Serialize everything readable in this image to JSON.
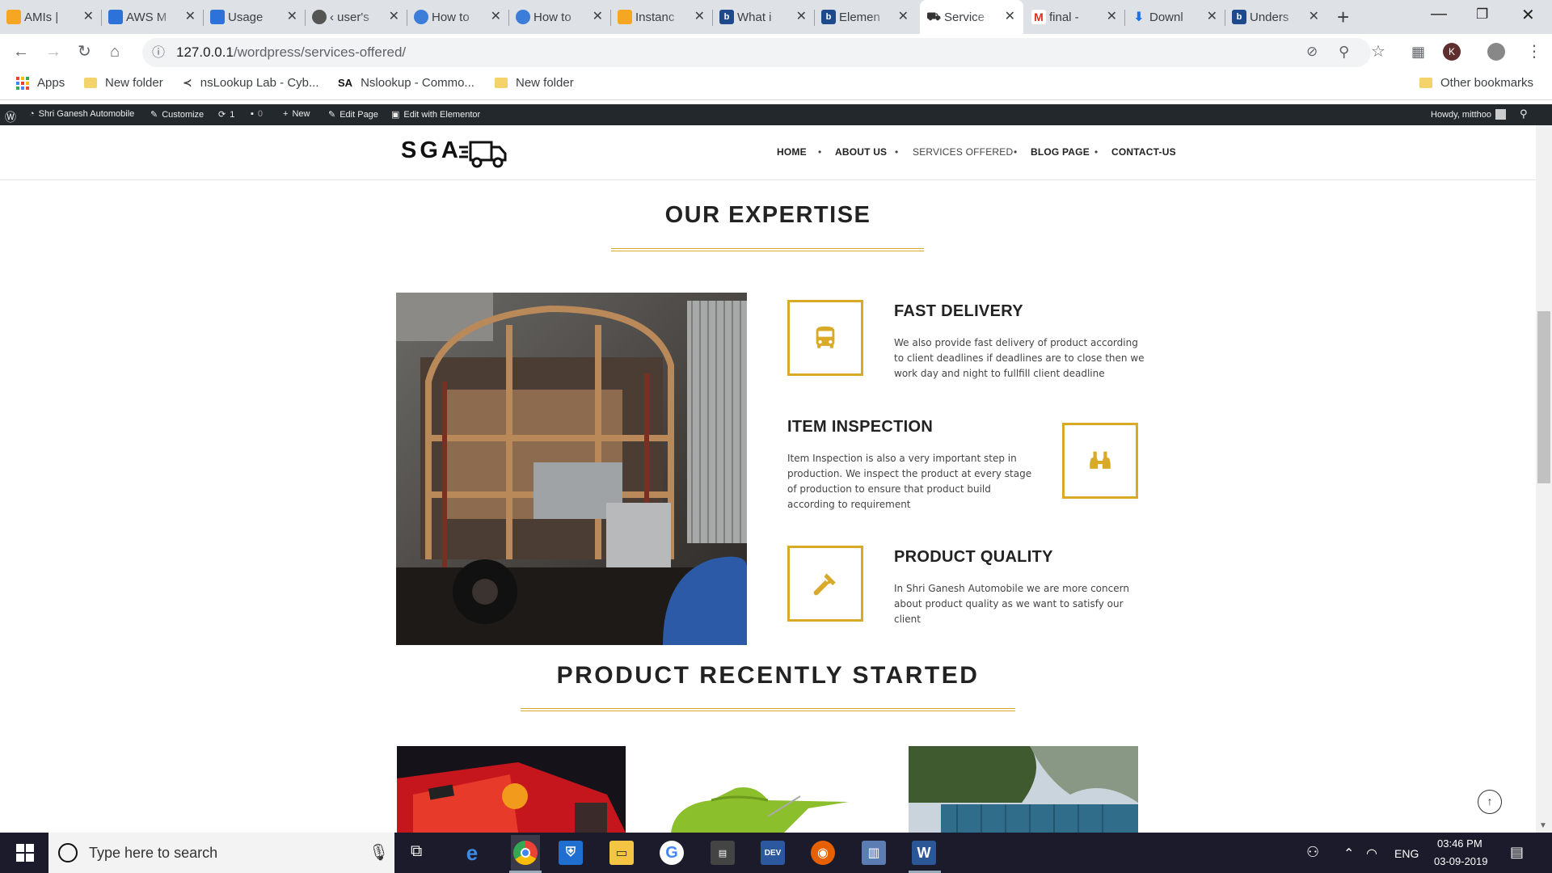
{
  "browser": {
    "tabs": [
      {
        "title": "AMIs |",
        "icon": "aws-cube-icon",
        "color": "#f5a623"
      },
      {
        "title": "AWS M",
        "icon": "aws-hex-icon",
        "color": "#2d72d9"
      },
      {
        "title": "Usage",
        "icon": "aws-hex-icon",
        "color": "#2d72d9"
      },
      {
        "title": "‹ user's",
        "icon": "wordpress-icon",
        "color": "#555555"
      },
      {
        "title": "How to",
        "icon": "people-icon",
        "color": "#3b7dd8"
      },
      {
        "title": "How to",
        "icon": "people-icon",
        "color": "#3b7dd8"
      },
      {
        "title": "Instanc",
        "icon": "aws-cube-icon",
        "color": "#f5a623"
      },
      {
        "title": "What i",
        "icon": "bing-icon",
        "color": "#1e4a8c"
      },
      {
        "title": "Elemen",
        "icon": "bing-icon",
        "color": "#1e4a8c"
      },
      {
        "title": "Service",
        "icon": "truck-icon",
        "color": "#333333",
        "active": true
      },
      {
        "title": "final -",
        "icon": "gmail-icon",
        "color": "#d93025"
      },
      {
        "title": "Downl",
        "icon": "download-icon",
        "color": "#1a73e8"
      },
      {
        "title": "Unders",
        "icon": "bing-icon",
        "color": "#1e4a8c"
      }
    ],
    "url_host": "127.0.0.1",
    "url_path": "/wordpress/services-offered/",
    "bookmarks": [
      "Apps",
      "New folder",
      "nsLookup Lab - Cyb...",
      "Nslookup - Commo...",
      "New folder"
    ],
    "other_bookmarks": "Other bookmarks",
    "profile_letter": "K"
  },
  "adminbar": {
    "site": "Shri Ganesh Automobile",
    "customize": "Customize",
    "updates": "1",
    "comments": "0",
    "new": "New",
    "edit_page": "Edit Page",
    "elementor": "Edit with Elementor",
    "howdy": "Howdy, mitthoo"
  },
  "site": {
    "logo": "SGA",
    "nav": [
      "HOME",
      "ABOUT US",
      "SERVICES OFFERED",
      "BLOG PAGE",
      "CONTACT-US"
    ]
  },
  "main": {
    "expertise_title": "OUR EXPERTISE",
    "features": [
      {
        "title": "FAST DELIVERY",
        "desc": "We also provide fast delivery of product according to client deadlines if deadlines are to close then we work day and night to fullfill client deadline",
        "icon": "bus-icon"
      },
      {
        "title": "ITEM INSPECTION",
        "desc": "Item Inspection is also a very important step in production. We inspect the product at every stage of production to ensure that product build according to requirement",
        "icon": "binoculars-icon"
      },
      {
        "title": "PRODUCT QUALITY",
        "desc": "In Shri Ganesh Automobile we are more concern about product quality as we want to satisfy our client",
        "icon": "hammer-icon"
      }
    ],
    "recent_title": "PRODUCT RECENTLY STARTED",
    "accent": "#d9a928"
  },
  "taskbar": {
    "search_placeholder": "Type here to search",
    "lang": "ENG",
    "time": "03:46 PM",
    "date": "03-09-2019"
  }
}
